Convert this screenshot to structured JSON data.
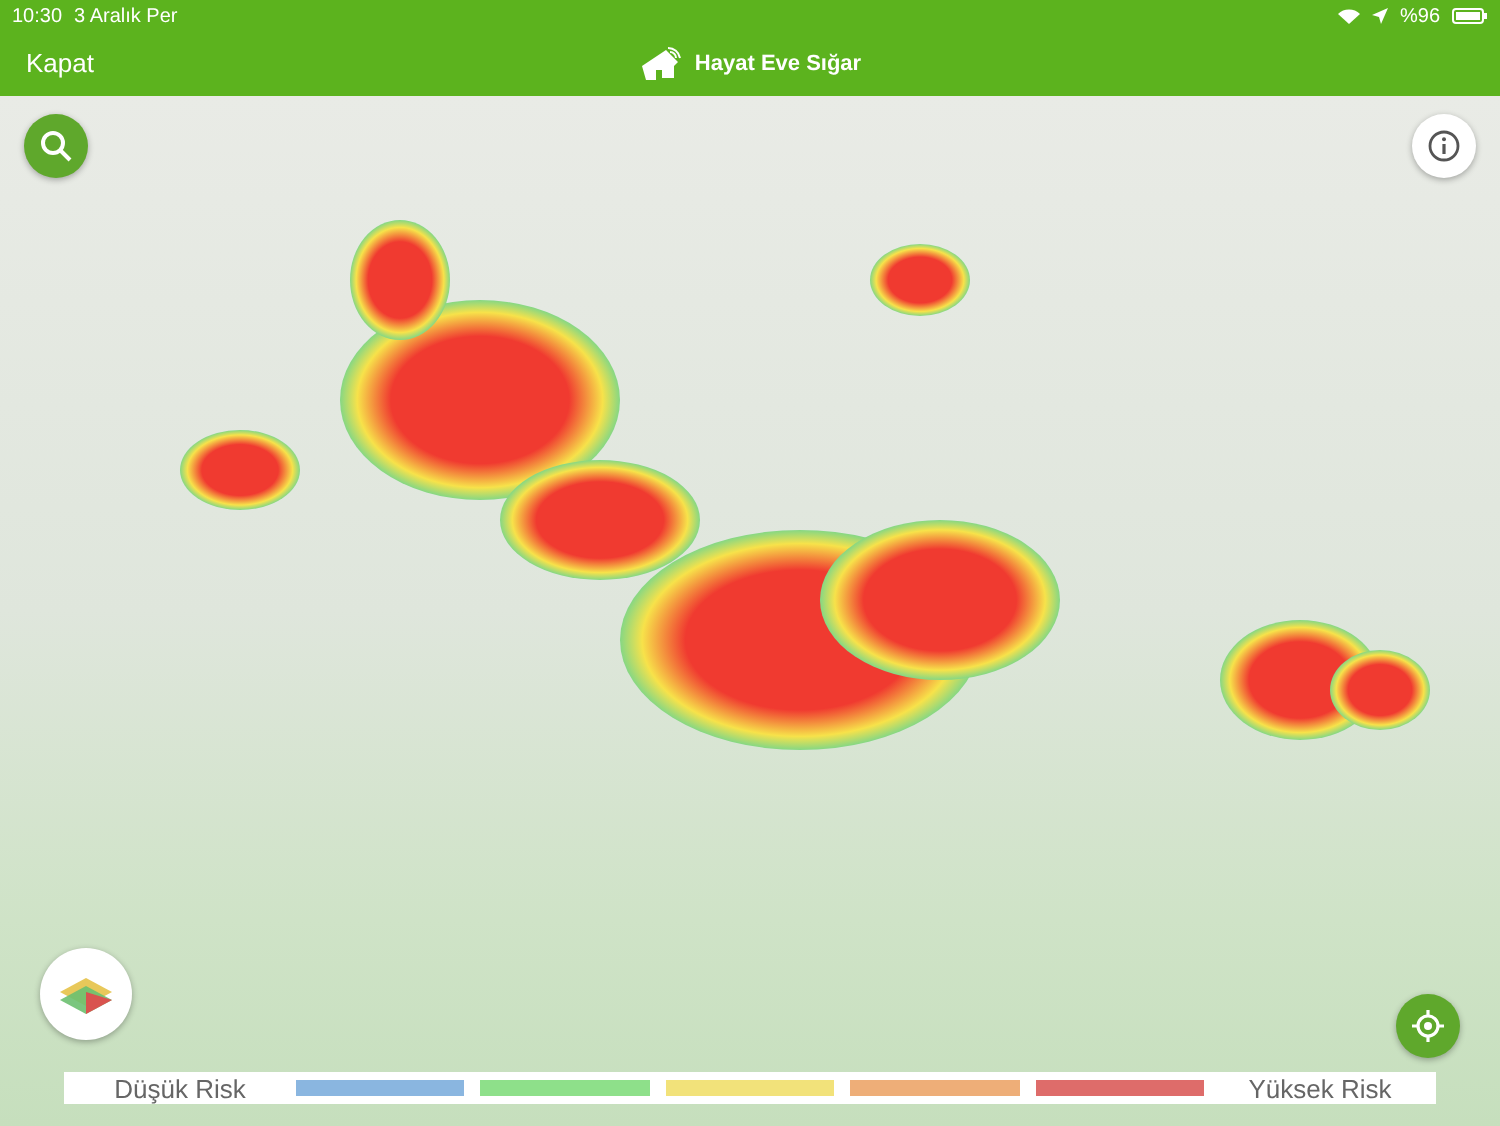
{
  "status_bar": {
    "time": "10:30",
    "date": "3 Aralık Per",
    "battery": "%96"
  },
  "header": {
    "close": "Kapat",
    "title": "Hayat Eve Sığar"
  },
  "legend": {
    "low": "Düşük Risk",
    "high": "Yüksek Risk",
    "segments": [
      {
        "color": "#8ab6e0"
      },
      {
        "color": "#8ee08a"
      },
      {
        "color": "#f2e27a"
      },
      {
        "color": "#eeae78"
      },
      {
        "color": "#de6c6a"
      }
    ]
  }
}
